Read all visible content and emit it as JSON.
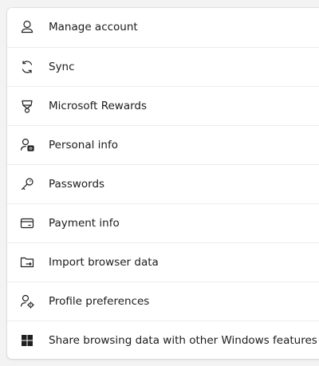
{
  "settings_menu": {
    "items": [
      {
        "label": "Manage account",
        "icon": "person-icon"
      },
      {
        "label": "Sync",
        "icon": "sync-icon"
      },
      {
        "label": "Microsoft Rewards",
        "icon": "trophy-icon"
      },
      {
        "label": "Personal info",
        "icon": "personal-info-icon"
      },
      {
        "label": "Passwords",
        "icon": "key-icon"
      },
      {
        "label": "Payment info",
        "icon": "credit-card-icon"
      },
      {
        "label": "Import browser data",
        "icon": "import-folder-icon"
      },
      {
        "label": "Profile preferences",
        "icon": "person-settings-icon"
      },
      {
        "label": "Share browsing data with other Windows features",
        "icon": "windows-logo-icon"
      }
    ]
  }
}
